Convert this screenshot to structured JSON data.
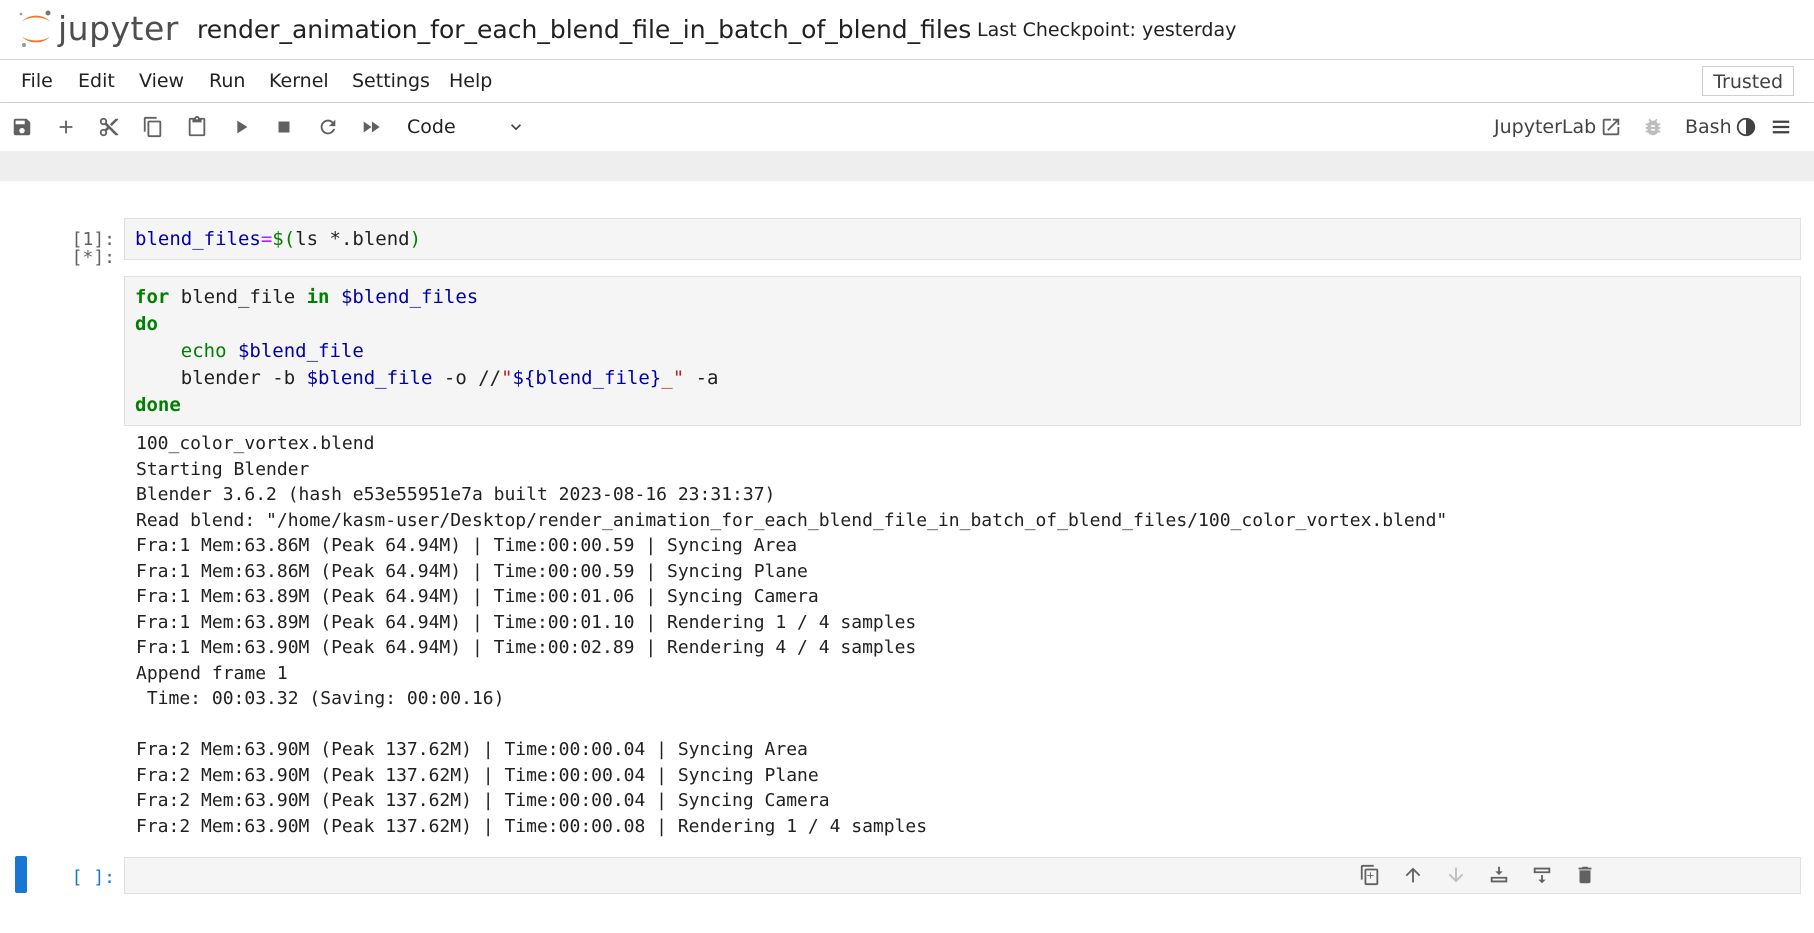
{
  "app": {
    "logo_text": "jupyter",
    "notebook_title": "render_animation_for_each_blend_file_in_batch_of_blend_files",
    "checkpoint": "Last Checkpoint: yesterday",
    "trusted": "Trusted"
  },
  "menu": {
    "items": [
      {
        "label": "File"
      },
      {
        "label": "Edit"
      },
      {
        "label": "View"
      },
      {
        "label": "Run"
      },
      {
        "label": "Kernel"
      },
      {
        "label": "Settings"
      },
      {
        "label": "Help"
      }
    ]
  },
  "toolbar": {
    "cell_type": "Code",
    "jupyterlab_label": "JupyterLab",
    "kernel_name": "Bash",
    "icons": [
      "save-icon",
      "add-cell-icon",
      "cut-icon",
      "copy-icon",
      "paste-icon",
      "run-icon",
      "stop-icon",
      "restart-icon",
      "fast-forward-icon",
      "external-link-icon",
      "bug-icon",
      "kernel-status-icon",
      "menu-icon"
    ]
  },
  "cells": [
    {
      "prompt": "[1]:",
      "code": [
        "blend_files=$(ls *.blend)"
      ]
    },
    {
      "prompt": "[*]:",
      "code": [
        "for blend_file in $blend_files",
        "do",
        "    echo $blend_file",
        "    blender -b $blend_file -o //\"${blend_file}_\" -a",
        "done"
      ],
      "output": [
        "100_color_vortex.blend",
        "Starting Blender",
        "Blender 3.6.2 (hash e53e55951e7a built 2023-08-16 23:31:37)",
        "Read blend: \"/home/kasm-user/Desktop/render_animation_for_each_blend_file_in_batch_of_blend_files/100_color_vortex.blend\"",
        "Fra:1 Mem:63.86M (Peak 64.94M) | Time:00:00.59 | Syncing Area",
        "Fra:1 Mem:63.86M (Peak 64.94M) | Time:00:00.59 | Syncing Plane",
        "Fra:1 Mem:63.89M (Peak 64.94M) | Time:00:01.06 | Syncing Camera",
        "Fra:1 Mem:63.89M (Peak 64.94M) | Time:00:01.10 | Rendering 1 / 4 samples",
        "Fra:1 Mem:63.90M (Peak 64.94M) | Time:00:02.89 | Rendering 4 / 4 samples",
        "Append frame 1",
        " Time: 00:03.32 (Saving: 00:00.16)",
        "",
        "Fra:2 Mem:63.90M (Peak 137.62M) | Time:00:00.04 | Syncing Area",
        "Fra:2 Mem:63.90M (Peak 137.62M) | Time:00:00.04 | Syncing Plane",
        "Fra:2 Mem:63.90M (Peak 137.62M) | Time:00:00.04 | Syncing Camera",
        "Fra:2 Mem:63.90M (Peak 137.62M) | Time:00:00.08 | Rendering 1 / 4 samples"
      ]
    },
    {
      "prompt": "[ ]:",
      "code": [
        ""
      ]
    }
  ],
  "cell_toolbar": {
    "icons": [
      "duplicate-cell-icon",
      "move-up-icon",
      "move-down-icon",
      "insert-above-icon",
      "insert-below-icon",
      "delete-cell-icon"
    ]
  }
}
